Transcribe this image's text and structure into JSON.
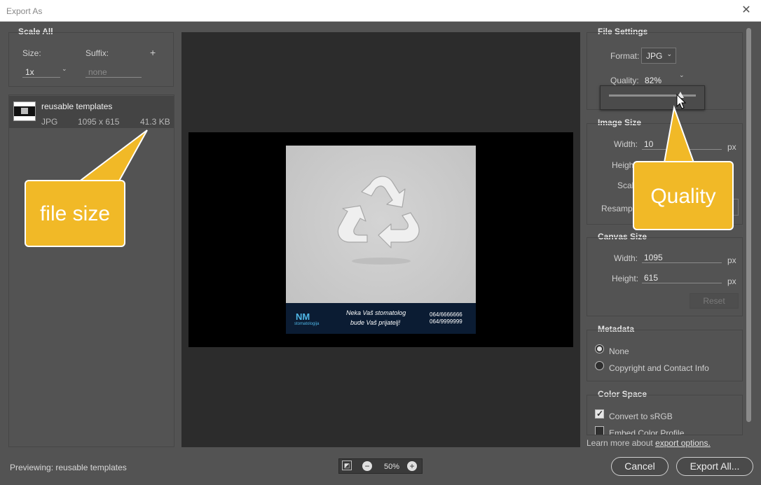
{
  "window": {
    "title": "Export As",
    "close_glyph": "✕"
  },
  "scale_all": {
    "heading": "Scale All",
    "size_label": "Size:",
    "size_value": "1x",
    "suffix_label": "Suffix:",
    "suffix_placeholder": "none",
    "add_glyph": "+"
  },
  "asset": {
    "name": "reusable templates",
    "format": "JPG",
    "dimensions": "1095 x 615",
    "filesize": "41.3 KB"
  },
  "preview": {
    "logo": "NM",
    "logo_sub": "stomatologija",
    "slogan_line1": "Neka Vaš stomatolog",
    "slogan_line2": "bude Vaš prijatelj!",
    "phone1": "064/6666666",
    "phone2": "064/9999999"
  },
  "file_settings": {
    "heading": "File Settings",
    "format_label": "Format:",
    "format_value": "JPG",
    "quality_label": "Quality:",
    "quality_value": "82%",
    "quality_fraction": 0.82
  },
  "image_size": {
    "heading": "Image Size",
    "width_label": "Width:",
    "width_value": "10",
    "height_label": "Heigh",
    "scale_label": "Scal",
    "resample_label": "Resampl",
    "unit": "px"
  },
  "canvas_size": {
    "heading": "Canvas Size",
    "width_label": "Width:",
    "width_value": "1095",
    "height_label": "Height:",
    "height_value": "615",
    "unit": "px",
    "reset_label": "Reset"
  },
  "metadata": {
    "heading": "Metadata",
    "option_none": "None",
    "option_copyright": "Copyright and Contact Info"
  },
  "color_space": {
    "heading": "Color Space",
    "convert_label": "Convert to sRGB",
    "embed_label": "Embed Color Profile"
  },
  "learn_more": {
    "prefix": "Learn more about ",
    "link": "export options."
  },
  "callouts": {
    "file_size": "file size",
    "quality": "Quality"
  },
  "status": {
    "previewing": "Previewing:  reusable templates"
  },
  "zoom": {
    "level": "50%",
    "fit_icon": "fit-screen-icon",
    "minus": "−",
    "plus": "+"
  },
  "buttons": {
    "cancel": "Cancel",
    "export_all": "Export All..."
  },
  "colors": {
    "callout": "#f1b927",
    "panel": "#535353",
    "preview_bg": "#2c2c2c"
  }
}
